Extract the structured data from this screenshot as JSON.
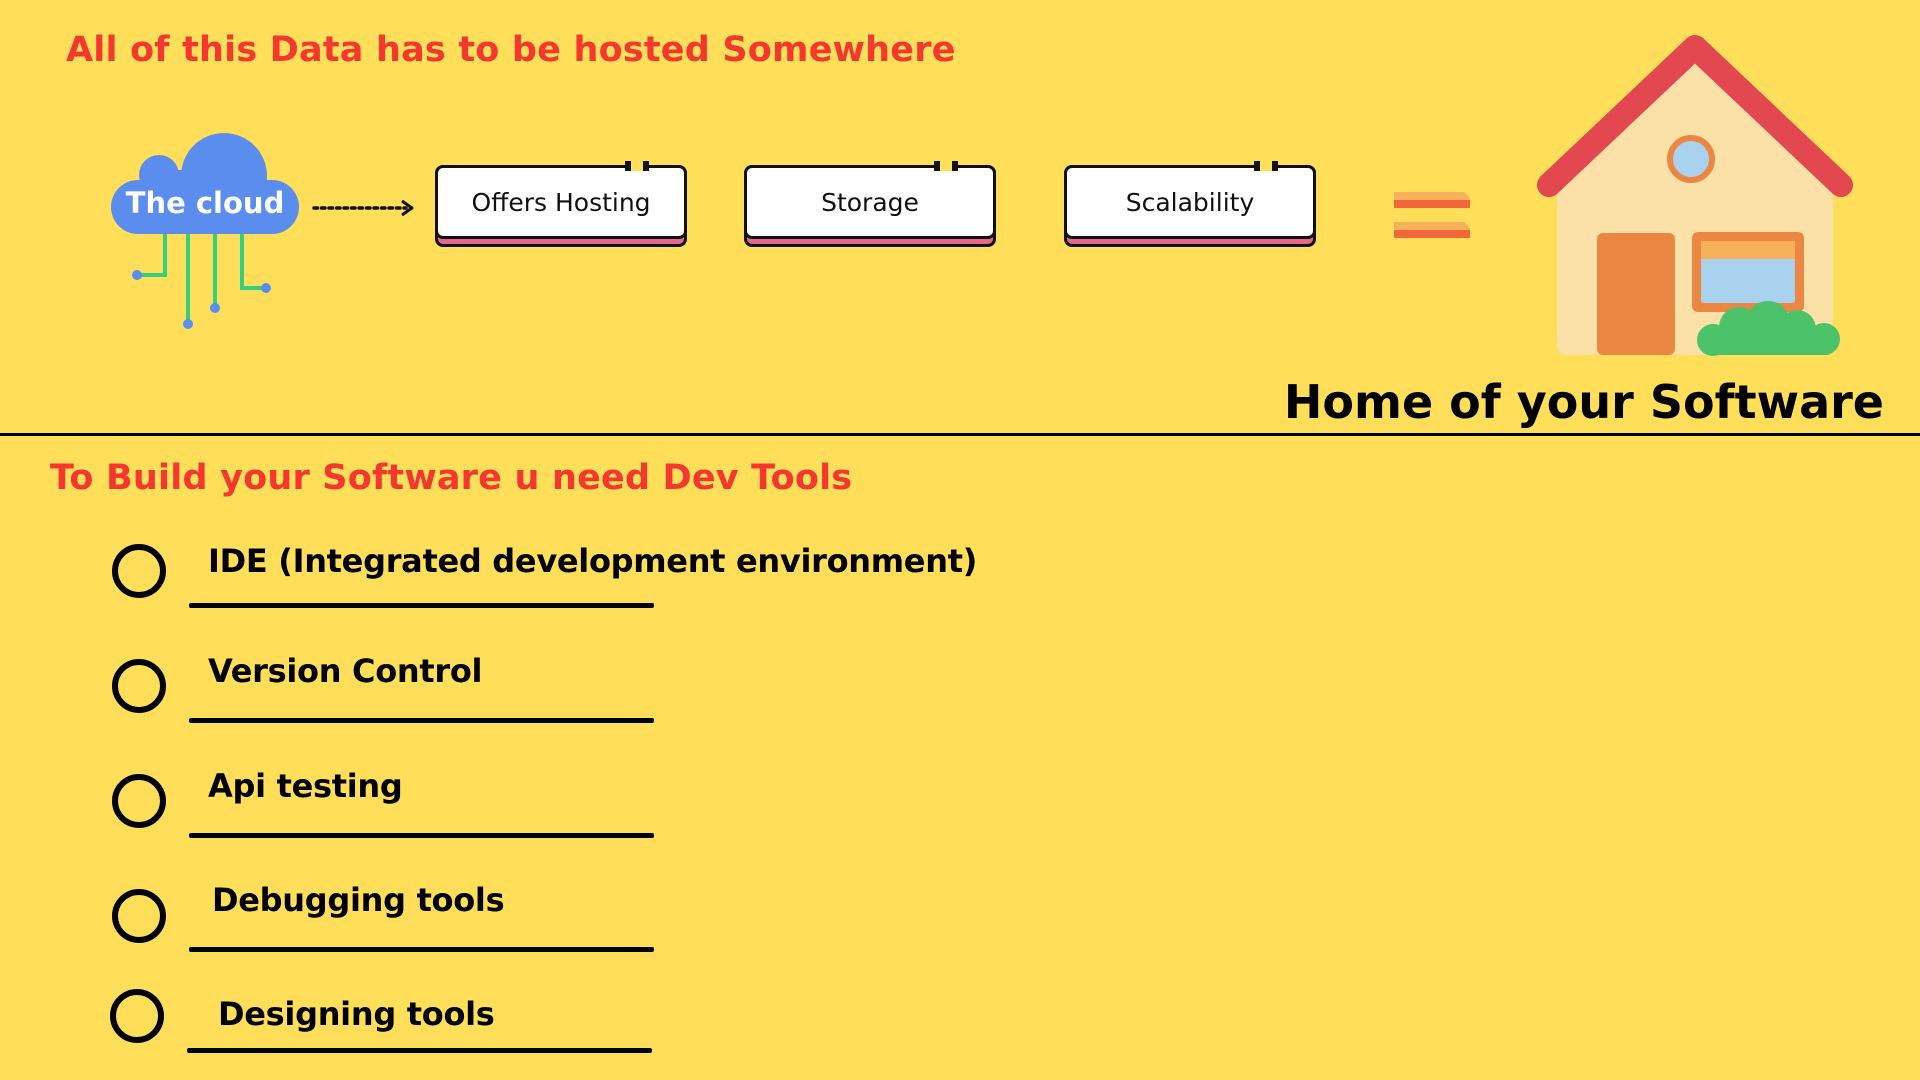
{
  "hosting": {
    "title": "All of this Data has to be hosted Somewhere",
    "cloud_label": "The cloud",
    "features": [
      {
        "label": "Offers Hosting"
      },
      {
        "label": "Storage"
      },
      {
        "label": "Scalability"
      }
    ],
    "caption": "Home of your Software"
  },
  "devtools": {
    "title": "To Build your Software u need Dev Tools",
    "items": [
      {
        "label": "IDE (Integrated development environment)"
      },
      {
        "label": "Version Control"
      },
      {
        "label": "Api testing"
      },
      {
        "label": "Debugging tools"
      },
      {
        "label": "Designing tools"
      }
    ]
  },
  "colors": {
    "background": "#FFDE59",
    "heading": "#F4372F",
    "cloud": "#5B8DEF",
    "circuit": "#35D07F",
    "box_base": "#E3688A",
    "roof": "#E3474F",
    "wall": "#FBE0A8",
    "door": "#EC8643",
    "window_frame": "#EC8643",
    "window_glass": "#A8D2EE",
    "bush": "#4CC36A",
    "equals": "#F6914A"
  },
  "icons": {
    "cloud": "cloud-network-icon",
    "arrow": "dotted-arrow-right-icon",
    "equals": "equals-sign-icon",
    "house": "house-icon",
    "bullet": "circle-outline-icon"
  }
}
